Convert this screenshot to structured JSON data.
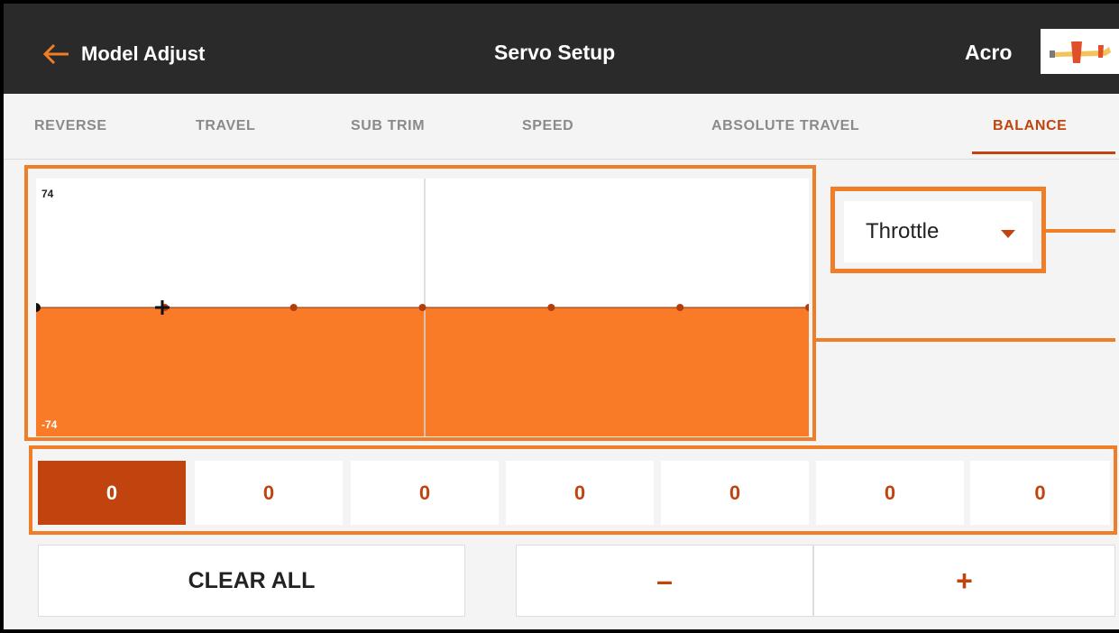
{
  "header": {
    "back_label": "Model Adjust",
    "title": "Servo Setup",
    "model_name": "Acro"
  },
  "tabs": [
    {
      "label": "REVERSE",
      "active": false
    },
    {
      "label": "TRAVEL",
      "active": false
    },
    {
      "label": "SUB TRIM",
      "active": false
    },
    {
      "label": "SPEED",
      "active": false
    },
    {
      "label": "ABSOLUTE TRAVEL",
      "active": false
    },
    {
      "label": "BALANCE",
      "active": true
    }
  ],
  "curve": {
    "max_label": "74",
    "min_label": "-74",
    "points": [
      0,
      0,
      0,
      0,
      0,
      0,
      0
    ],
    "selected_point": 0
  },
  "channel": {
    "selected": "Throttle"
  },
  "buttons": {
    "clear_all": "CLEAR ALL",
    "minus": "–",
    "plus": "+"
  },
  "colors": {
    "accent": "#c1440e",
    "fill": "#f97a27",
    "header_bg": "#2a2a2a",
    "annotation": "#f07d27"
  },
  "icons": {
    "back": "arrow-left-icon",
    "dropdown": "caret-down-icon",
    "model": "airplane-thumbnail-icon"
  }
}
